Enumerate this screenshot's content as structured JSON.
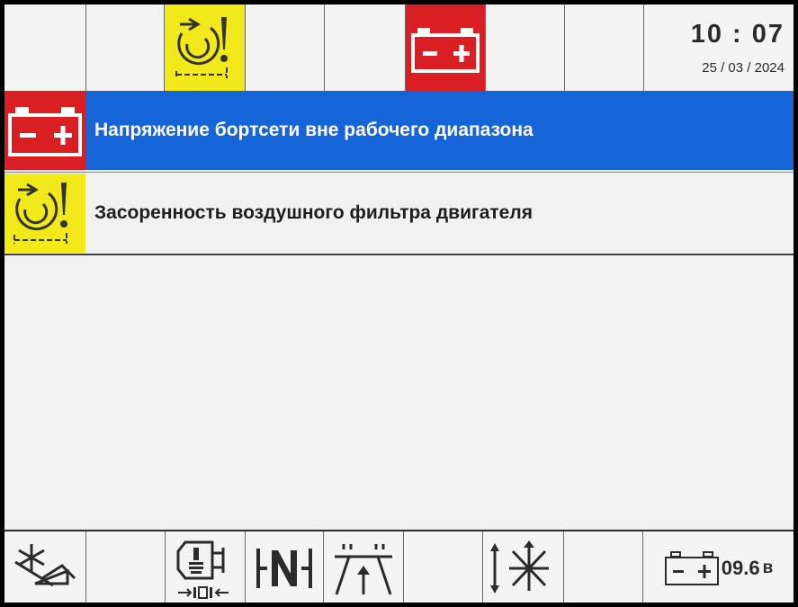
{
  "header": {
    "status_icons": [
      "air-filter-warning-icon",
      "battery-icon"
    ],
    "time": "10 : 07",
    "date": "25 / 03 / 2024"
  },
  "alerts": [
    {
      "icon": "battery-icon",
      "text": "Напряжение бортсети вне рабочего диапазона",
      "selected": true
    },
    {
      "icon": "air-filter-warning-icon",
      "text": "Засоренность воздушного фильтра двигателя",
      "selected": false
    }
  ],
  "footer": {
    "icons": [
      "fan-off-icon",
      "transmission-oil-icon",
      "neutral-gear-icon",
      "lift-mast-icon",
      "hydraulic-spread-icon",
      "battery-voltage-icon"
    ],
    "voltage": "09.6",
    "voltage_unit": "в"
  },
  "colors": {
    "selected_row": "#1565d8",
    "warning_yellow": "#f2e91a",
    "alarm_red": "#da1f22"
  }
}
